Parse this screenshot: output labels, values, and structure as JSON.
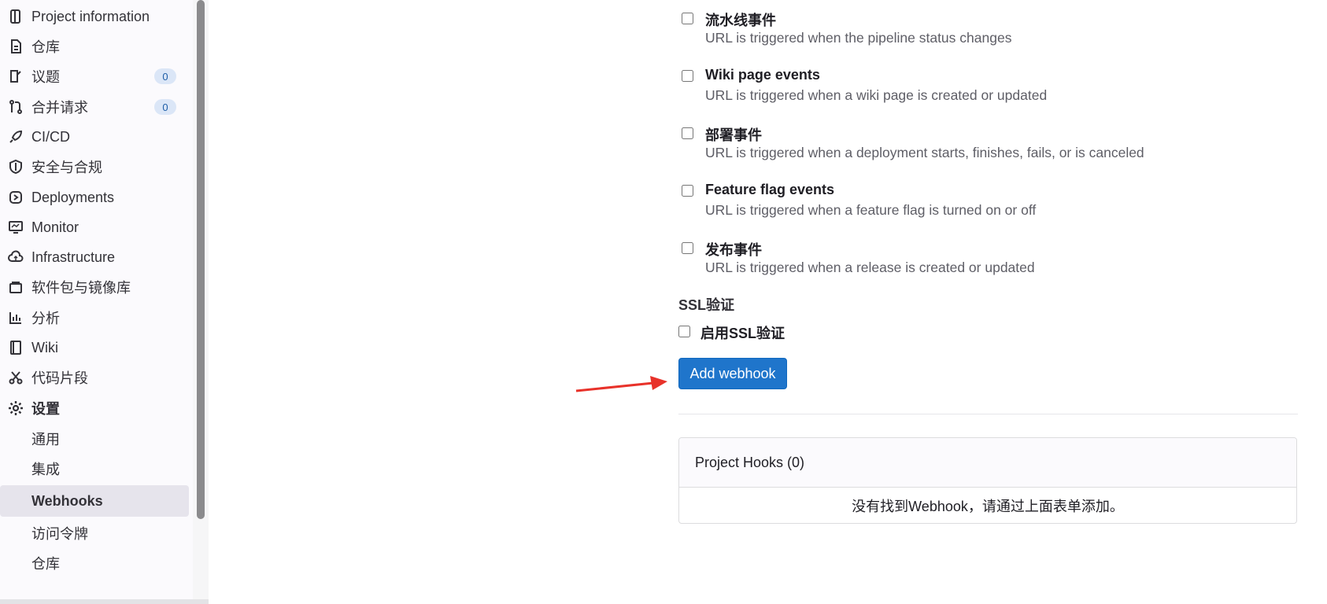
{
  "sidebar": {
    "items": [
      {
        "label": "Project information",
        "icon": "project-icon"
      },
      {
        "label": "仓库",
        "icon": "repository-icon"
      },
      {
        "label": "议题",
        "icon": "issues-icon",
        "badge": "0"
      },
      {
        "label": "合并请求",
        "icon": "merge-request-icon",
        "badge": "0"
      },
      {
        "label": "CI/CD",
        "icon": "rocket-icon"
      },
      {
        "label": "安全与合规",
        "icon": "shield-icon"
      },
      {
        "label": "Deployments",
        "icon": "deployments-icon"
      },
      {
        "label": "Monitor",
        "icon": "monitor-icon"
      },
      {
        "label": "Infrastructure",
        "icon": "cloud-icon"
      },
      {
        "label": "软件包与镜像库",
        "icon": "package-icon"
      },
      {
        "label": "分析",
        "icon": "chart-icon"
      },
      {
        "label": "Wiki",
        "icon": "book-icon"
      },
      {
        "label": "代码片段",
        "icon": "scissors-icon"
      },
      {
        "label": "设置",
        "icon": "gear-icon"
      }
    ],
    "settings_subitems": [
      {
        "label": "通用"
      },
      {
        "label": "集成"
      },
      {
        "label": "Webhooks",
        "active": true
      },
      {
        "label": "访问令牌"
      },
      {
        "label": "仓库"
      }
    ]
  },
  "events": [
    {
      "title": "流水线事件",
      "desc": "URL is triggered when the pipeline status changes"
    },
    {
      "title": "Wiki page events",
      "desc": "URL is triggered when a wiki page is created or updated"
    },
    {
      "title": "部署事件",
      "desc": "URL is triggered when a deployment starts, finishes, fails, or is canceled"
    },
    {
      "title": "Feature flag events",
      "desc": "URL is triggered when a feature flag is turned on or off"
    },
    {
      "title": "发布事件",
      "desc": "URL is triggered when a release is created or updated"
    }
  ],
  "ssl": {
    "section_title": "SSL验证",
    "checkbox_label": "启用SSL验证"
  },
  "add_button_label": "Add webhook",
  "hooks": {
    "header": "Project Hooks (0)",
    "empty_message": "没有找到Webhook，请通过上面表单添加。"
  },
  "colors": {
    "primary": "#1f75cb",
    "annotation_arrow": "#e8322a"
  }
}
